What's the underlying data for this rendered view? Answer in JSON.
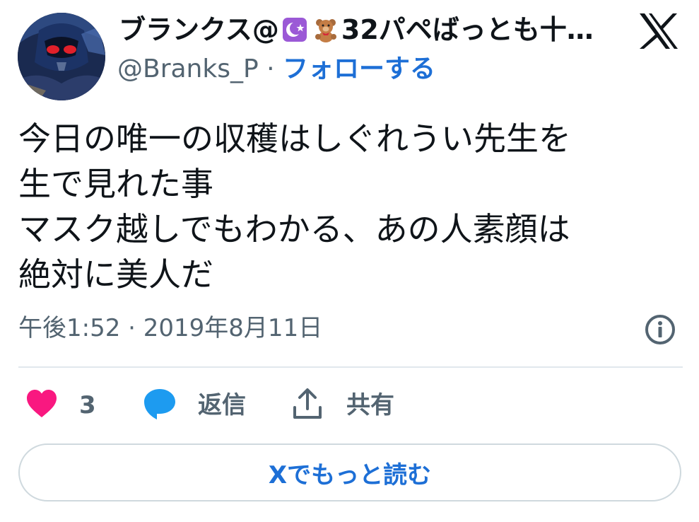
{
  "author": {
    "display_name": "ブランクス@",
    "display_name_tail": "32パペばっとも十…",
    "name_emojis": [
      "crescent-star-icon",
      "teddy-bear-icon"
    ],
    "handle": "@Branks_P",
    "separator": "·",
    "follow_label": "フォローする"
  },
  "tweet": {
    "text": "今日の唯一の収穫はしぐれうい先生を\n生で見れた事\nマスク越しでもわかる、あの人素顔は\n絶対に美人だ",
    "timestamp": "午後1:52 · 2019年8月11日"
  },
  "actions": {
    "like_count": "3",
    "reply_label": "返信",
    "share_label": "共有"
  },
  "read_more_label": "Xでもっと読む",
  "colors": {
    "accent": "#1d6fd6",
    "like": "#f91880",
    "reply": "#1d9bf0",
    "muted": "#536471"
  }
}
